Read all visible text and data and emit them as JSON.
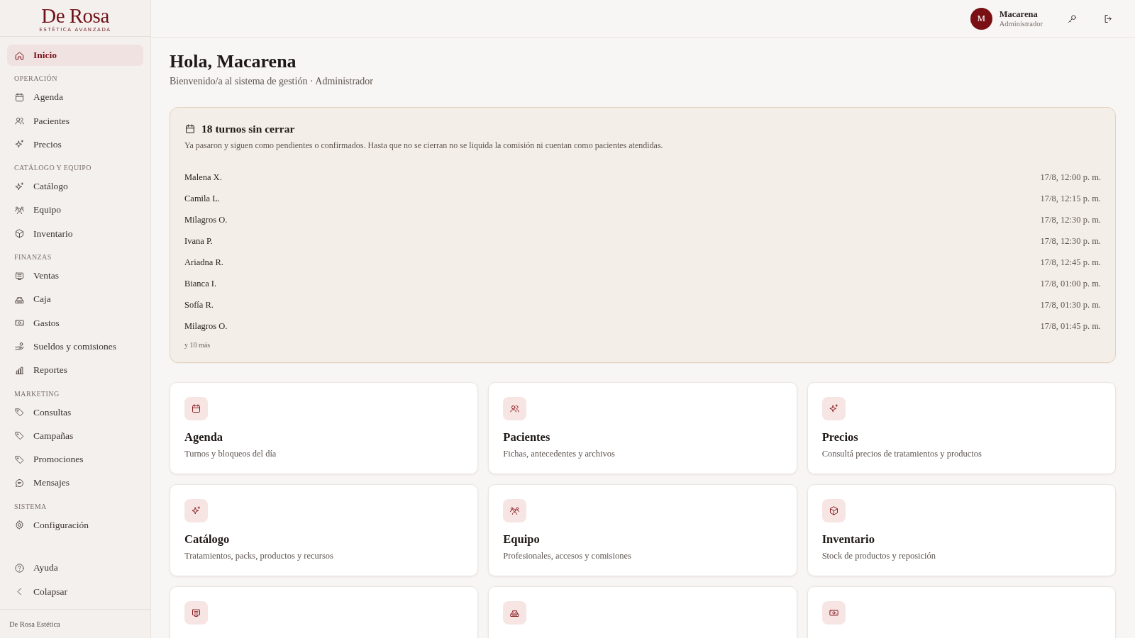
{
  "brand": {
    "name": "De Rosa",
    "tagline": "ESTÉTICA AVANZADA"
  },
  "sidebar": {
    "items": [
      {
        "label": "Inicio",
        "selected": true
      }
    ],
    "sections": [
      {
        "title": "OPERACIÓN",
        "items": [
          {
            "label": "Agenda",
            "selected": false
          },
          {
            "label": "Pacientes",
            "selected": false
          },
          {
            "label": "Precios",
            "selected": false
          }
        ]
      },
      {
        "title": "CATÁLOGO Y EQUIPO",
        "items": [
          {
            "label": "Catálogo",
            "selected": false
          },
          {
            "label": "Equipo",
            "selected": false
          },
          {
            "label": "Inventario",
            "selected": false
          }
        ]
      },
      {
        "title": "FINANZAS",
        "items": [
          {
            "label": "Ventas",
            "selected": false
          },
          {
            "label": "Caja",
            "selected": false
          },
          {
            "label": "Gastos",
            "selected": false
          },
          {
            "label": "Sueldos y comisiones",
            "selected": false
          },
          {
            "label": "Reportes",
            "selected": false
          }
        ]
      },
      {
        "title": "MARKETING",
        "items": [
          {
            "label": "Consultas",
            "selected": false
          },
          {
            "label": "Campañas",
            "selected": false
          },
          {
            "label": "Promociones",
            "selected": false
          },
          {
            "label": "Mensajes",
            "selected": false
          }
        ]
      },
      {
        "title": "SISTEMA",
        "items": [
          {
            "label": "Configuración",
            "selected": false
          }
        ]
      }
    ],
    "bottom_items": [
      {
        "label": "Ayuda"
      },
      {
        "label": "Colapsar"
      }
    ],
    "footer": "De Rosa Estética"
  },
  "header": {
    "user": {
      "initial": "M",
      "name": "Macarena",
      "role": "Administrador"
    }
  },
  "greeting": {
    "title": "Hola, Macarena",
    "subtitle": "Bienvenido/a al sistema de gestión · Administrador"
  },
  "alert": {
    "title": "18 turnos sin cerrar",
    "description": "Ya pasaron y siguen como pendientes o confirmados. Hasta que no se cierran no se liquida la comisión ni cuentan como pacientes atendidas.",
    "rows": [
      {
        "name": "Malena X.",
        "time": "17/8, 12:00 p. m."
      },
      {
        "name": "Camila L.",
        "time": "17/8, 12:15 p. m."
      },
      {
        "name": "Milagros O.",
        "time": "17/8, 12:30 p. m."
      },
      {
        "name": "Ivana P.",
        "time": "17/8, 12:30 p. m."
      },
      {
        "name": "Ariadna R.",
        "time": "17/8, 12:45 p. m."
      },
      {
        "name": "Bianca I.",
        "time": "17/8, 01:00 p. m."
      },
      {
        "name": "Sofía R.",
        "time": "17/8, 01:30 p. m."
      },
      {
        "name": "Milagros O.",
        "time": "17/8, 01:45 p. m."
      }
    ],
    "more": "y 10 más"
  },
  "cards": [
    {
      "kind": "full",
      "title": "Agenda",
      "description": "Turnos y bloqueos del día"
    },
    {
      "kind": "full",
      "title": "Pacientes",
      "description": "Fichas, antecedentes y archivos"
    },
    {
      "kind": "full",
      "title": "Precios",
      "description": "Consultá precios de tratamientos y productos"
    },
    {
      "kind": "full",
      "title": "Catálogo",
      "description": "Tratamientos, packs, productos y recursos"
    },
    {
      "kind": "full",
      "title": "Equipo",
      "description": "Profesionales, accesos y comisiones"
    },
    {
      "kind": "full",
      "title": "Inventario",
      "description": "Stock de productos y reposición"
    },
    {
      "kind": "cut_off"
    },
    {
      "kind": "cut_off"
    },
    {
      "kind": "cut_off"
    }
  ]
}
